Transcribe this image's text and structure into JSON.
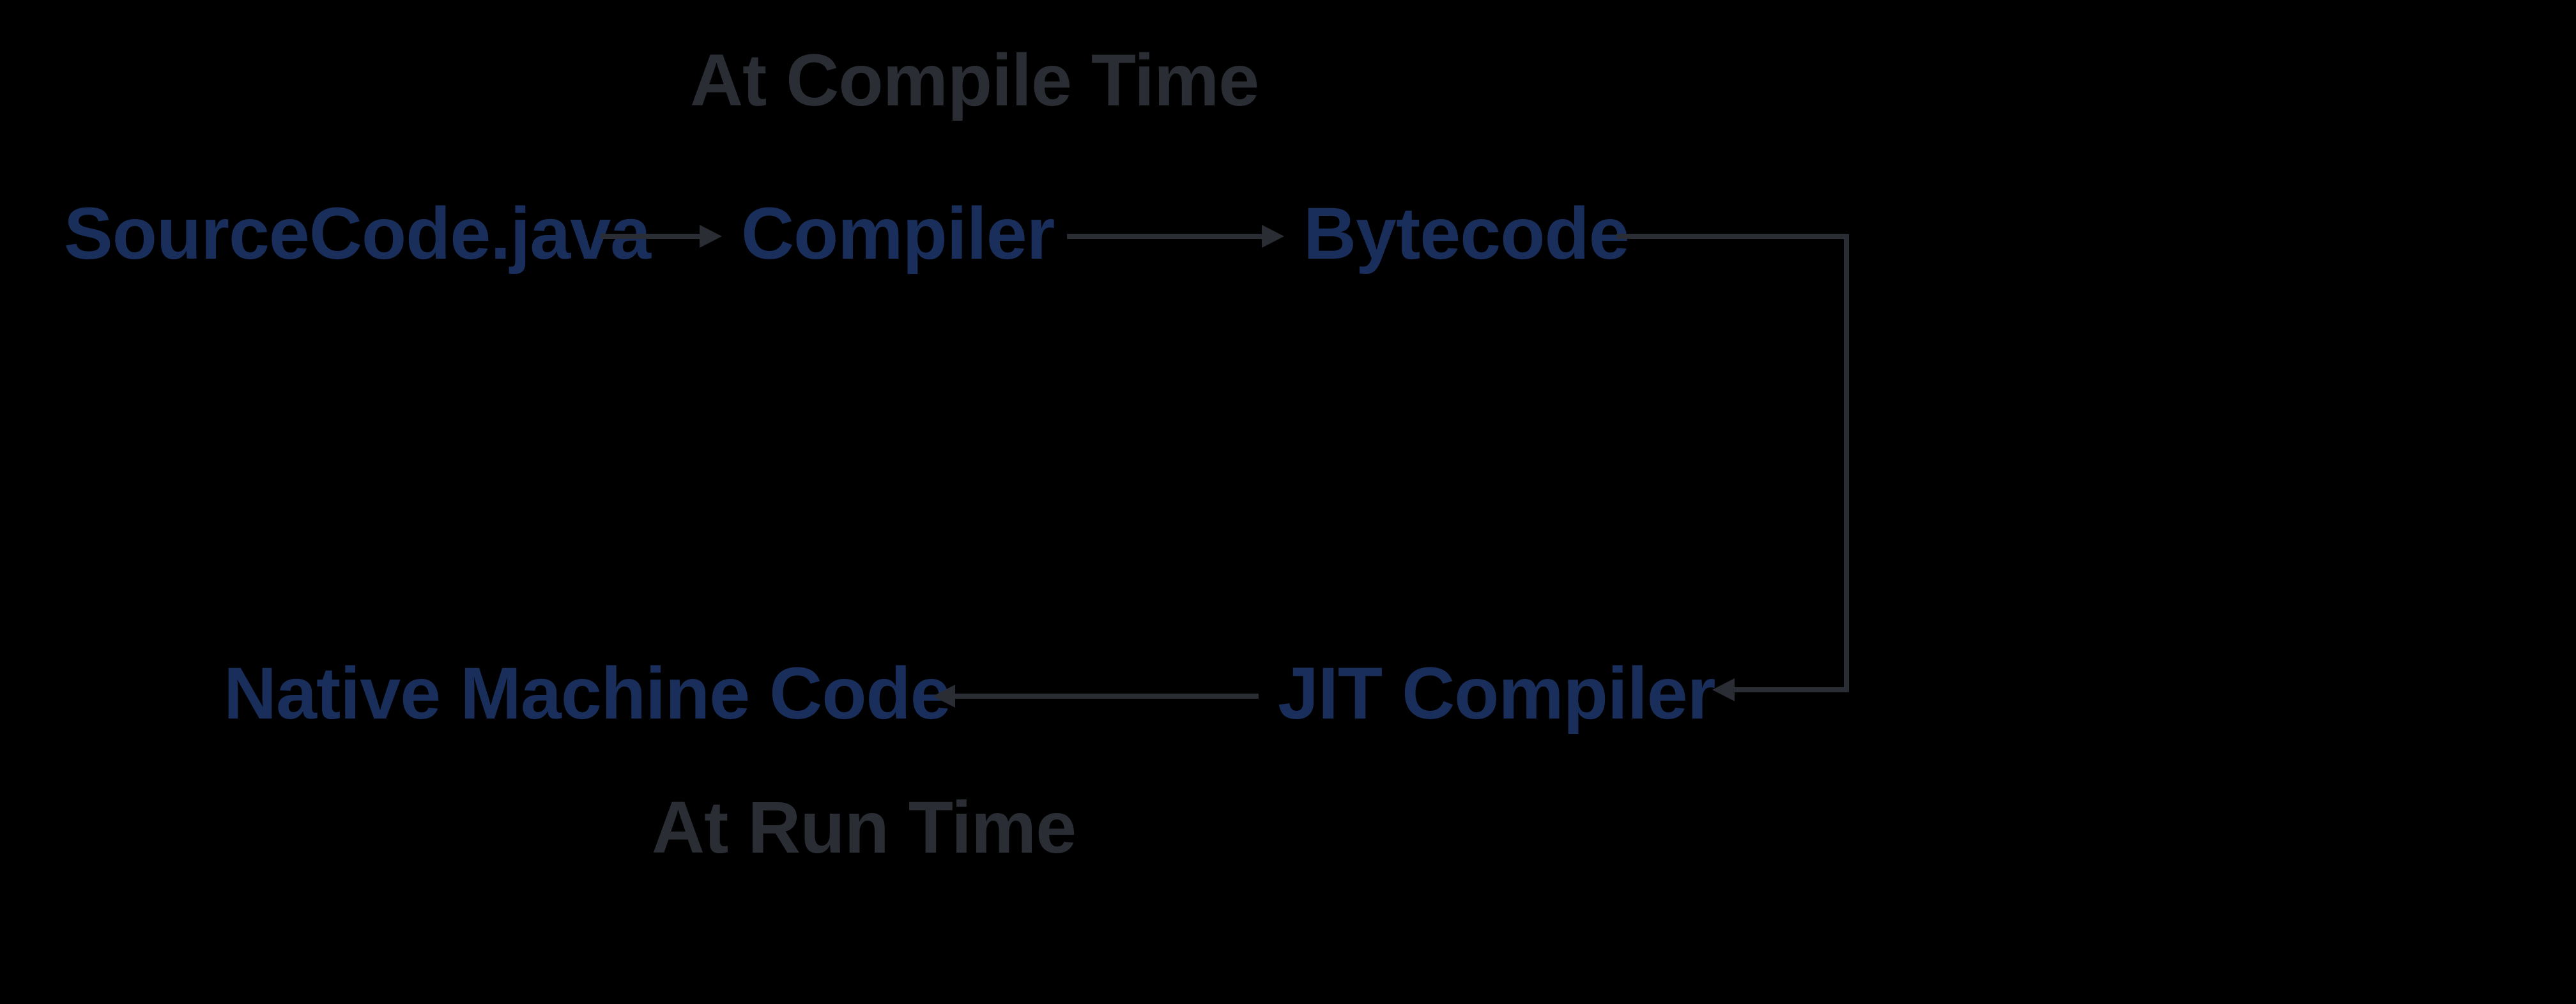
{
  "headers": {
    "top": "At Compile Time",
    "bottom": "At Run Time"
  },
  "nodes": {
    "source": "SourceCode.java",
    "compiler": "Compiler",
    "bytecode": "Bytecode",
    "jit": "JIT Compiler",
    "native": "Native Machine Code"
  }
}
